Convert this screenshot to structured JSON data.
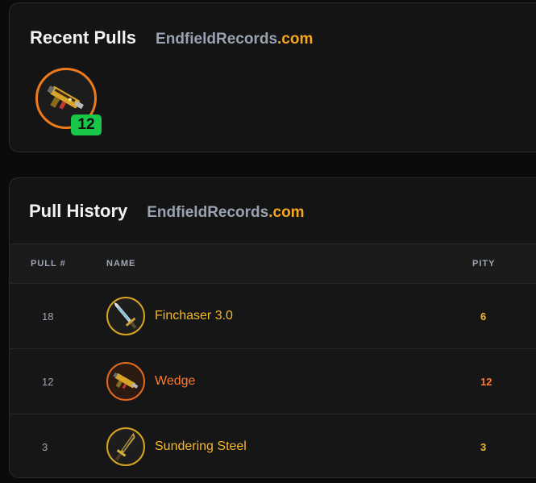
{
  "recent": {
    "title": "Recent Pulls",
    "brand_name": "EndfieldRecords",
    "brand_tld": ".com",
    "pulls": [
      {
        "icon": "rifle-icon",
        "pity": "12",
        "rarity_color": "#f07a1a"
      }
    ]
  },
  "history": {
    "title": "Pull History",
    "brand_name": "EndfieldRecords",
    "brand_tld": ".com",
    "columns": {
      "pull": "PULL #",
      "name": "NAME",
      "pity": "PITY"
    },
    "rows": [
      {
        "pull": "18",
        "name": "Finchaser 3.0",
        "pity": "6",
        "icon": "sword-icon",
        "color": "#f5b82a"
      },
      {
        "pull": "12",
        "name": "Wedge",
        "pity": "12",
        "icon": "rifle-icon",
        "color": "#ff7a2e"
      },
      {
        "pull": "3",
        "name": "Sundering Steel",
        "pity": "3",
        "icon": "blade-icon",
        "color": "#f5b82a"
      }
    ]
  },
  "colors": {
    "accent": "#f5a623",
    "brand_gray": "#9aa3b2",
    "badge_green": "#18c64a"
  }
}
